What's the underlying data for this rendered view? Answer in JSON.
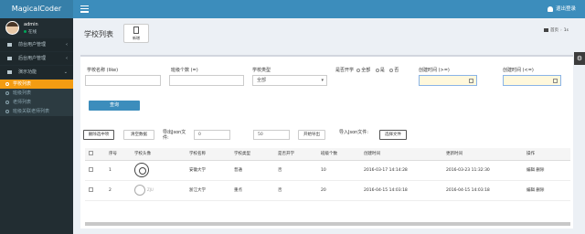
{
  "app": {
    "logo": "MagicalCoder",
    "logout_label": "退出登录"
  },
  "sidebar": {
    "user_name": "admin",
    "user_status": "在线",
    "menu": [
      {
        "label": "前台用户管理",
        "type": "top"
      },
      {
        "label": "后台用户管理",
        "type": "top"
      },
      {
        "label": "演示功能",
        "type": "top"
      },
      {
        "label": "学校列表",
        "type": "sub",
        "active": true
      },
      {
        "label": "班级列表",
        "type": "sub"
      },
      {
        "label": "老师列表",
        "type": "sub"
      },
      {
        "label": "班级关联老师列表",
        "type": "sub"
      }
    ]
  },
  "header": {
    "page_title": "学校列表",
    "add_label": "新增",
    "breadcrumb_home": "首页",
    "breadcrumb_current": "1s"
  },
  "filters": {
    "school_name_label": "学校名称 (like)",
    "class_count_label": "班级个数 (=)",
    "school_type_label": "学校类型",
    "school_type_value": "全部",
    "is_open_label": "是否开学",
    "radio_all": "全部",
    "radio_yes": "是",
    "radio_no": "否",
    "created_gte_label": "创建时间 (>=)",
    "created_lte_label": "创建时间 (<=)",
    "query_label": "查询"
  },
  "toolbar": {
    "delete_selected": "删除选中项",
    "clear_data": "清空数据",
    "export_label": "导出Json文件:",
    "export_from": "0",
    "export_to": "50",
    "export_button": "开始导出",
    "import_label": "导入Json文件:",
    "choose_file": "选择文件"
  },
  "table": {
    "headers": [
      "",
      "序号",
      "学校头像",
      "学校名称",
      "学校类型",
      "是否开学",
      "班级个数",
      "创建时间",
      "更新时间",
      "操作"
    ],
    "rows": [
      {
        "index": "1",
        "name": "安徽大学",
        "type": "普通",
        "open": "否",
        "class_count": "10",
        "created": "2016-03-17 14:14:28",
        "updated": "2016-03-23 11:32:30",
        "actions": "编辑 删除"
      },
      {
        "index": "2",
        "name": "浙江大学",
        "type": "重点",
        "open": "否",
        "class_count": "20",
        "created": "2016-04-15 14:03:18",
        "updated": "2016-04-15 14:03:18",
        "actions": "编辑 删除"
      }
    ]
  },
  "colors": {
    "header_blue": "#3c8dbc",
    "sidebar_dark": "#222d32",
    "active_orange": "#f39c12"
  }
}
